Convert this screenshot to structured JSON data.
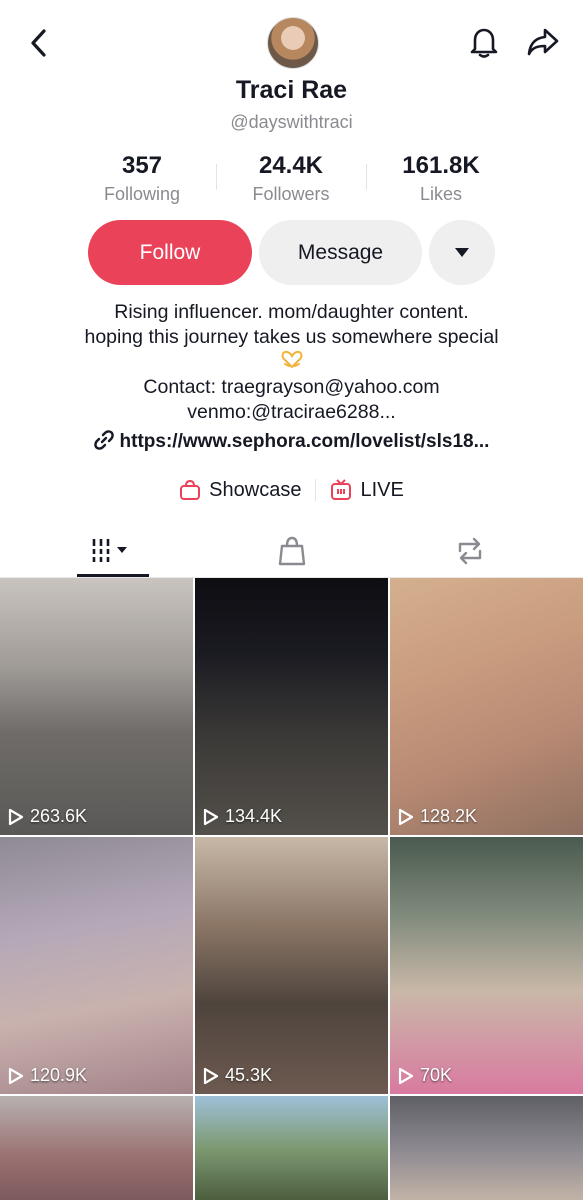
{
  "header": {
    "name": "Traci Rae",
    "handle": "@dayswithtraci",
    "icons": [
      "chevron-left-icon",
      "bell-icon",
      "share-icon"
    ]
  },
  "stats": [
    {
      "value": "357",
      "label": "Following"
    },
    {
      "value": "24.4K",
      "label": "Followers"
    },
    {
      "value": "161.8K",
      "label": "Likes"
    }
  ],
  "actions": {
    "follow": "Follow",
    "message": "Message"
  },
  "bio": {
    "line1": "Rising influencer. mom/daughter content.",
    "line2": "hoping this journey takes us somewhere special",
    "line3": "Contact: traegrayson@yahoo.com",
    "line4": "venmo:@tracirae6288...",
    "link": "https://www.sephora.com/lovelist/sls18..."
  },
  "extras": {
    "showcase": "Showcase",
    "live": "LIVE"
  },
  "colors": {
    "accent": "#ea4359",
    "muted": "#8a8b91"
  },
  "videos": [
    {
      "views": "263.6K"
    },
    {
      "views": "134.4K"
    },
    {
      "views": "128.2K"
    },
    {
      "views": "120.9K"
    },
    {
      "views": "45.3K"
    },
    {
      "views": "70K"
    },
    {
      "views": ""
    },
    {
      "views": ""
    },
    {
      "views": ""
    }
  ]
}
